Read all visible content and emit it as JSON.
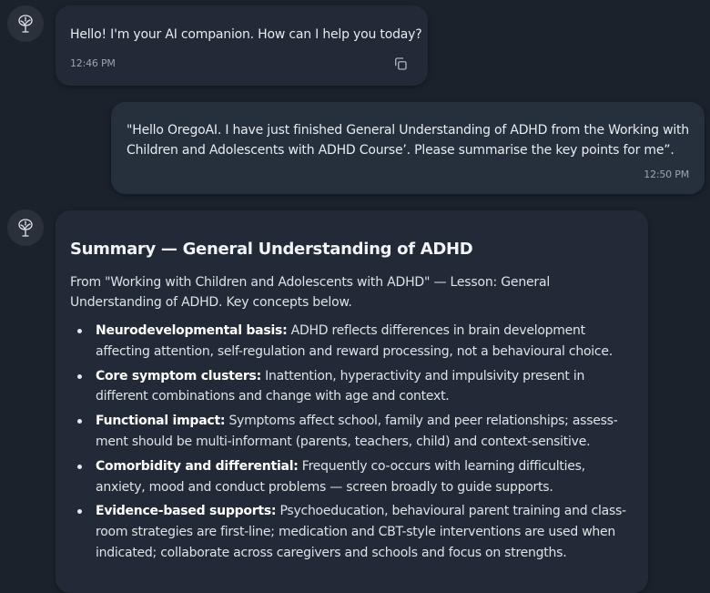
{
  "messages": [
    {
      "role": "assistant",
      "text": "Hello! I'm your AI companion. How can I help you today?",
      "time": "12:46 PM"
    },
    {
      "role": "user",
      "text": "\"Hello OregoAI. I have just finished General Understanding of ADHD from the Working with Children and Adolescents with ADHD Course’. Please summarise the key points for me”.",
      "time": "12:50 PM"
    }
  ],
  "summary": {
    "title": "Summary — General Understanding of ADHD",
    "intro": "From \"Working with Children and Adolescents with ADHD\" — Lesson: General Understanding of ADHD. Key concepts below.",
    "points": [
      {
        "label": "Neurodevelopmental basis:",
        "text": " ADHD reflects differences in brain development affecting attention, self-regulation and reward processing, not a behavioural choice."
      },
      {
        "label": "Core symptom clusters:",
        "text": " Inattention, hyperactivity and impulsivity present in different combinations and change with age and context."
      },
      {
        "label": "Functional impact:",
        "text": " Symptoms affect school, family and peer relationships; assess-ment should be multi-informant (parents, teachers, child) and context-sensitive."
      },
      {
        "label": "Comorbidity and differential:",
        "text": " Frequently co-occurs with learning difficulties, anxiety, mood and conduct problems — screen broadly to guide supports."
      },
      {
        "label": "Evidence-based supports:",
        "text": " Psychoeducation, behavioural parent training and class-room strategies are first-line; medication and CBT-style interventions are used when indicated; collaborate across caregivers and schools and focus on strengths."
      }
    ]
  },
  "icons": {
    "avatar": "brain-tree-icon",
    "copy": "copy-icon"
  }
}
